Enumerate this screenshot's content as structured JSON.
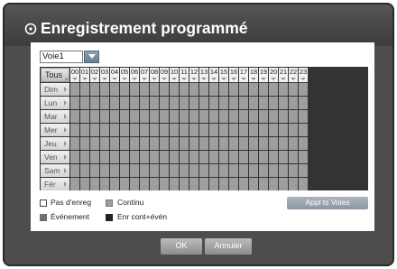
{
  "dialog": {
    "title": "Enregistrement programmé",
    "title_icon": "clock-icon"
  },
  "channel_select": {
    "value": "Voie1",
    "icon": "chevron-down-icon"
  },
  "schedule": {
    "all_label": "Tous",
    "hours": [
      "00",
      "01",
      "02",
      "03",
      "04",
      "05",
      "06",
      "07",
      "08",
      "09",
      "10",
      "11",
      "12",
      "13",
      "14",
      "15",
      "16",
      "17",
      "18",
      "19",
      "20",
      "21",
      "22",
      "23"
    ],
    "days": [
      "Dim",
      "Lun",
      "Mar",
      "Mer",
      "Jeu",
      "Ven",
      "Sam",
      "Fér"
    ],
    "cell_color": "#9e9e9e"
  },
  "legend": {
    "items": [
      {
        "label": "Pas d'enreg",
        "color": "#ffffff"
      },
      {
        "label": "Continu",
        "color": "#9e9e9e"
      },
      {
        "label": "Événement",
        "color": "#6e6e6e"
      },
      {
        "label": "Enr cont+évén",
        "color": "#222222"
      }
    ]
  },
  "apply_all_label": "Appl ts Voies",
  "footer": {
    "ok_label": "OK",
    "cancel_label": "Annuler"
  }
}
